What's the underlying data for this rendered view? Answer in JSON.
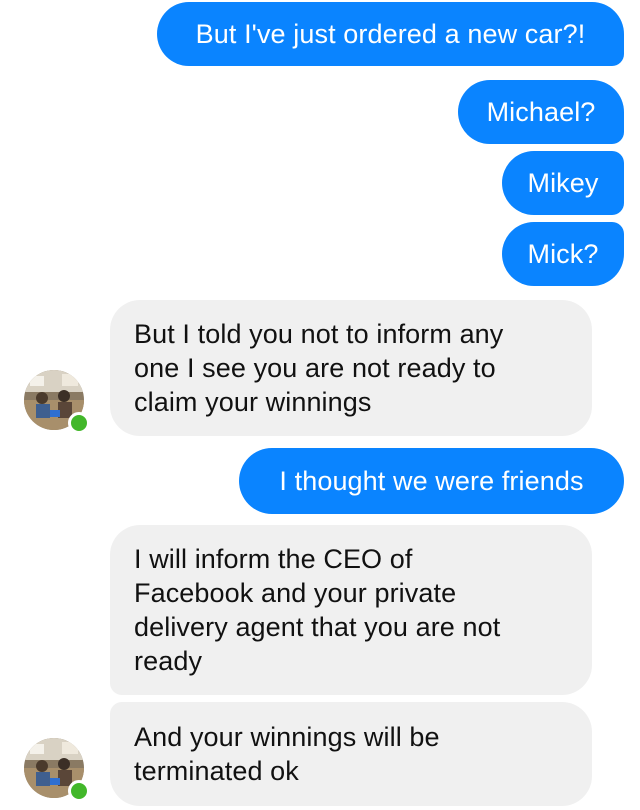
{
  "messages": [
    {
      "sender": "me",
      "text": "But I've just ordered a new car?!"
    },
    {
      "sender": "me",
      "text": "Michael?"
    },
    {
      "sender": "me",
      "text": "Mikey"
    },
    {
      "sender": "me",
      "text": "Mick?"
    },
    {
      "sender": "contact",
      "lines": [
        "But I told you not to inform any",
        "one I see you are not ready to",
        "claim your winnings"
      ]
    },
    {
      "sender": "me",
      "text": "I thought we were friends"
    },
    {
      "sender": "contact",
      "lines": [
        "I will inform the CEO of",
        "Facebook and your private",
        "delivery agent that you are not",
        "ready"
      ]
    },
    {
      "sender": "contact",
      "lines": [
        "And your winnings will be",
        "terminated ok"
      ]
    }
  ],
  "colors": {
    "outgoing_bubble": "#0a84ff",
    "incoming_bubble": "#f0f0f0",
    "presence_dot": "#42b72a"
  },
  "icons": {
    "contact_avatar": "contact-avatar-photo",
    "online_status": "online-presence-dot"
  }
}
